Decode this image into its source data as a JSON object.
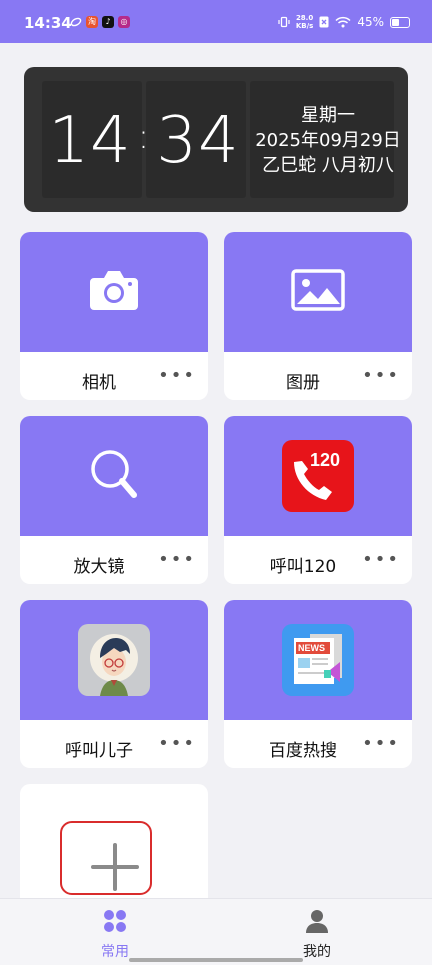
{
  "status_bar": {
    "time": "14:34",
    "net_speed": "28.0",
    "net_unit": "KB/s",
    "battery": "45%",
    "battery_level": 0.45,
    "app_icons": [
      "sync-icon",
      "app-badge-icon",
      "tiktok-icon",
      "notification-app-icon"
    ]
  },
  "clock": {
    "hours": "14",
    "minutes": "34",
    "weekday": "星期一",
    "date": "2025年09月29日",
    "lunar": "乙巳蛇 八月初八"
  },
  "tiles": [
    {
      "label": "相机",
      "icon": "camera-icon"
    },
    {
      "label": "图册",
      "icon": "gallery-icon"
    },
    {
      "label": "放大镜",
      "icon": "magnifier-icon"
    },
    {
      "label": "呼叫120",
      "icon": "emergency-call-icon",
      "icon_text": "120"
    },
    {
      "label": "呼叫儿子",
      "icon": "son-avatar-icon"
    },
    {
      "label": "百度热搜",
      "icon": "news-icon",
      "icon_text": "NEWS"
    }
  ],
  "more_label": "•••",
  "nav": {
    "items": [
      {
        "label": "常用",
        "icon": "grid-icon",
        "active": true
      },
      {
        "label": "我的",
        "icon": "person-icon",
        "active": false
      }
    ]
  },
  "colors": {
    "accent": "#8878f3",
    "clock_bg": "#333333",
    "add_highlight": "#d92c2c"
  }
}
